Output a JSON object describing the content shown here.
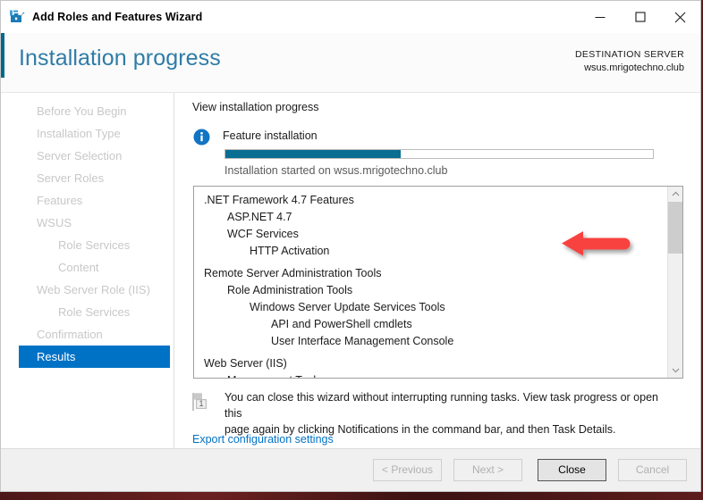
{
  "window": {
    "title": "Add Roles and Features Wizard",
    "app_icon": "server-manager-toolbox-icon",
    "controls": {
      "minimize": "minimize-icon",
      "maximize": "maximize-icon",
      "close": "close-icon"
    }
  },
  "header": {
    "page_title": "Installation progress",
    "destination_label": "DESTINATION SERVER",
    "destination_server": "wsus.mrigotechno.club",
    "accent_color": "#00688b",
    "title_color": "#2e7ca8"
  },
  "sidebar": {
    "items": [
      {
        "label": "Before You Begin",
        "level": 0,
        "active": false
      },
      {
        "label": "Installation Type",
        "level": 0,
        "active": false
      },
      {
        "label": "Server Selection",
        "level": 0,
        "active": false
      },
      {
        "label": "Server Roles",
        "level": 0,
        "active": false
      },
      {
        "label": "Features",
        "level": 0,
        "active": false
      },
      {
        "label": "WSUS",
        "level": 0,
        "active": false
      },
      {
        "label": "Role Services",
        "level": 1,
        "active": false
      },
      {
        "label": "Content",
        "level": 1,
        "active": false
      },
      {
        "label": "Web Server Role (IIS)",
        "level": 0,
        "active": false
      },
      {
        "label": "Role Services",
        "level": 1,
        "active": false
      },
      {
        "label": "Confirmation",
        "level": 0,
        "active": false
      },
      {
        "label": "Results",
        "level": 0,
        "active": true
      }
    ],
    "active_color": "#0072c6"
  },
  "main": {
    "view_progress_label": "View installation progress",
    "info_icon": "info-circle-icon",
    "feature_installation_label": "Feature installation",
    "progress": {
      "percent": 41,
      "fill_color": "#0a6e93"
    },
    "status_text": "Installation started on wsus.mrigotechno.club",
    "feature_list": [
      {
        "label": ".NET Framework 4.7 Features",
        "level": 0,
        "gap": false
      },
      {
        "label": "ASP.NET 4.7",
        "level": 1,
        "gap": false
      },
      {
        "label": "WCF Services",
        "level": 1,
        "gap": false
      },
      {
        "label": "HTTP Activation",
        "level": 2,
        "gap": false
      },
      {
        "label": "Remote Server Administration Tools",
        "level": 0,
        "gap": true
      },
      {
        "label": "Role Administration Tools",
        "level": 1,
        "gap": false
      },
      {
        "label": "Windows Server Update Services Tools",
        "level": 2,
        "gap": false
      },
      {
        "label": "API and PowerShell cmdlets",
        "level": 3,
        "gap": false
      },
      {
        "label": "User Interface Management Console",
        "level": 3,
        "gap": false
      },
      {
        "label": "Web Server (IIS)",
        "level": 0,
        "gap": true
      },
      {
        "label": "Management Tools",
        "level": 1,
        "gap": false
      }
    ],
    "scrollbar": {
      "up_arrow_icon": "chevron-up-icon",
      "down_arrow_icon": "chevron-down-icon"
    },
    "note_icon": "notification-flag-icon",
    "note_badge": "1",
    "note_line1": "You can close this wizard without interrupting running tasks. View task progress or open this",
    "note_line2": "page again by clicking Notifications in the command bar, and then Task Details.",
    "export_link": "Export configuration settings",
    "link_color": "#0072c6"
  },
  "footer": {
    "previous": "< Previous",
    "next": "Next >",
    "close": "Close",
    "cancel": "Cancel"
  },
  "annotation": {
    "arrow": "red-left-arrow-annotation",
    "color": "#f8423f"
  }
}
